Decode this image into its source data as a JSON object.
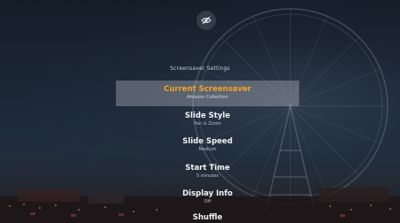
{
  "top_icon": "hidden-eye-icon",
  "screen_title": "Screensaver Settings",
  "menu": {
    "items": [
      {
        "label": "Current Screensaver",
        "value": "Amazon Collection"
      },
      {
        "label": "Slide Style",
        "value": "Pan & Zoom"
      },
      {
        "label": "Slide Speed",
        "value": "Medium"
      },
      {
        "label": "Start Time",
        "value": "5 minutes"
      },
      {
        "label": "Display Info",
        "value": "Off"
      },
      {
        "label": "Shuffle",
        "value": ""
      }
    ]
  },
  "colors": {
    "selected_label": "#f4a12a",
    "highlight_bar": "#c8cdd4"
  }
}
